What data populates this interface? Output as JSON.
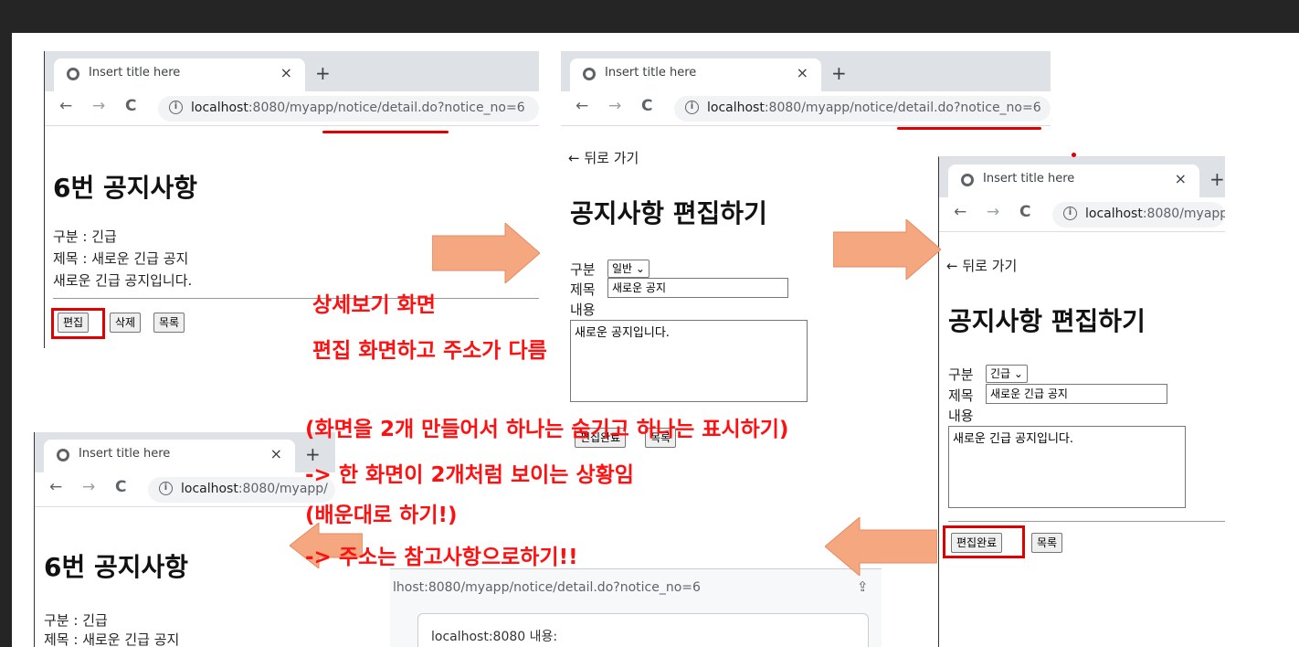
{
  "browser": {
    "tab_title": "Insert title here",
    "tab_close": "×",
    "new_tab": "+",
    "back": "←",
    "forward": "→",
    "reload": "C",
    "info": "i"
  },
  "win1": {
    "url_host": "localhost",
    "url_port": ":8080/myapp/notice/detail.do?notice_no=6",
    "heading": "6번 공지사항",
    "category_line": "구분 : 긴급",
    "title_line": "제목 : 새로운 긴급 공지",
    "content_line": "새로운 긴급 공지입니다.",
    "btn_edit": "편집",
    "btn_delete": "삭제",
    "btn_list": "목록"
  },
  "win2": {
    "url_host": "localhost",
    "url_port": ":8080/myapp/notice/detail.do?notice_no=6",
    "back_link": "← 뒤로 가기",
    "heading": "공지사항 편집하기",
    "label_category": "구분",
    "select_value": "일반",
    "label_title": "제목",
    "title_value": "새로운 공지",
    "label_content": "내용",
    "content_value": "새로운 공지입니다.",
    "btn_done": "편집완료",
    "btn_list": "목록"
  },
  "win3": {
    "url_host": "localhost",
    "url_port": ":8080/myapp",
    "back_link": "← 뒤로 가기",
    "heading": "공지사항 편집하기",
    "label_category": "구분",
    "select_value": "긴급",
    "label_title": "제목",
    "title_value": "새로운 긴급 공지",
    "label_content": "내용",
    "content_value": "새로운 긴급 공지입니다.",
    "btn_done": "편집완료",
    "btn_list": "목록"
  },
  "win4": {
    "url_host": "localhost",
    "url_port": ":8080/myapp/",
    "heading": "6번 공지사항",
    "category_line": "구분 : 긴급",
    "title_line": "제목 : 새로운 긴급 공지"
  },
  "popup": {
    "url": "lhost:8080/myapp/notice/detail.do?notice_no=6",
    "dialog_text": "localhost:8080 내용:"
  },
  "notes": {
    "line1": "상세보기 화면",
    "line2": "편집 화면하고 주소가 다름",
    "line3": "(화면을 2개 만들어서 하나는 숨기고 하나는 표시하기)",
    "line4": "-> 한 화면이 2개처럼 보이는 상황임",
    "line5": "(배운대로 하기!)",
    "line6": "-> 주소는 참고사항으로하기!!"
  },
  "colors": {
    "annotation": "#ff1010",
    "arrow": "#f5a77f",
    "frame": "#252526"
  }
}
